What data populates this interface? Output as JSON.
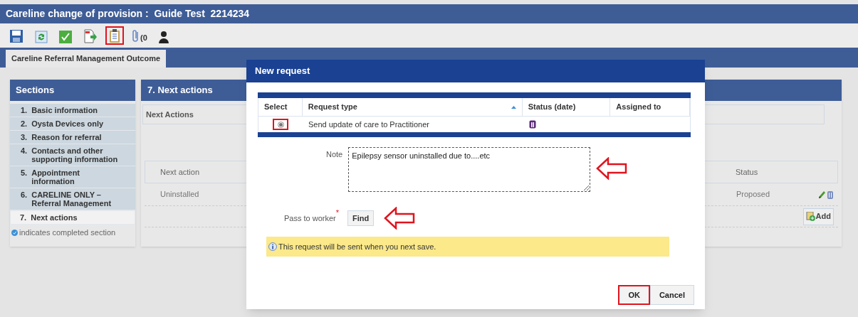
{
  "window": {
    "title": "Careline change of provision :  Guide Test  2214234"
  },
  "toolbar": [
    {
      "kind": "save",
      "highlighted": false
    },
    {
      "kind": "refresh",
      "highlighted": false
    },
    {
      "kind": "check",
      "highlighted": false
    },
    {
      "kind": "export",
      "highlighted": false
    },
    {
      "kind": "clipboard",
      "highlighted": true
    },
    {
      "kind": "attach",
      "highlighted": false,
      "label": "(0"
    },
    {
      "kind": "person",
      "highlighted": false
    }
  ],
  "tabs": [
    {
      "label": "Careline Referral Management Outcome",
      "selected": true
    }
  ],
  "sections": {
    "title": "Sections",
    "items": [
      {
        "number": "1.",
        "label": "Basic information",
        "selected": false
      },
      {
        "number": "2.",
        "label": "Oysta Devices only",
        "selected": false
      },
      {
        "number": "3.",
        "label": "Reason for referral",
        "selected": false
      },
      {
        "number": "4.",
        "label": "Contacts and other supporting information",
        "selected": false
      },
      {
        "number": "5.",
        "label": "Appointment information",
        "selected": false
      },
      {
        "number": "6.",
        "label": "CARELINE ONLY – Referral Management",
        "selected": false
      },
      {
        "number": "7.",
        "label": "Next actions",
        "selected": true
      }
    ],
    "legend": "indicates completed section"
  },
  "main": {
    "title": "7. Next actions",
    "subheading": "Next Actions",
    "columns": [
      "Next action",
      "Status"
    ],
    "rows": [
      {
        "action": "Uninstalled",
        "status": "Proposed"
      }
    ],
    "add_button": "Add"
  },
  "dialog": {
    "title": "New request",
    "columns": [
      "Select",
      "Request type",
      "Status (date)",
      "Assigned to"
    ],
    "rows": [
      {
        "selected": true,
        "highlighted": true,
        "request_type": "Send update of care to Practitioner"
      }
    ],
    "note": {
      "label": "Note",
      "value": "Epilepsy sensor uninstalled due to....etc",
      "arrow": true
    },
    "pass_to_worker": {
      "label": "Pass to worker",
      "required": "*",
      "button": "Find",
      "arrow": true
    },
    "info": "This request will be sent when you next save.",
    "buttons": [
      {
        "label": "OK",
        "highlighted": true
      },
      {
        "label": "Cancel",
        "highlighted": false
      }
    ]
  }
}
